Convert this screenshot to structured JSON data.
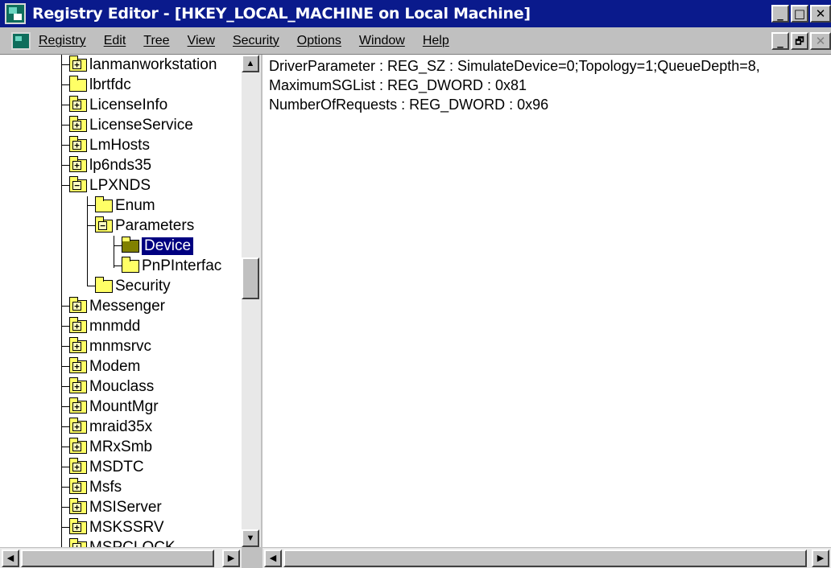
{
  "window": {
    "title": "Registry Editor - [HKEY_LOCAL_MACHINE on Local Machine]",
    "minimize_label": "_",
    "maximize_label": "□",
    "close_label": "✕",
    "mdi_minimize_label": "_",
    "mdi_restore_label": "🗗",
    "mdi_close_label": "✕"
  },
  "menu": [
    "Registry",
    "Edit",
    "Tree",
    "View",
    "Security",
    "Options",
    "Window",
    "Help"
  ],
  "tree": {
    "items": [
      {
        "label": "lanmanworkstation",
        "sign": "+"
      },
      {
        "label": "lbrtfdc",
        "sign": ""
      },
      {
        "label": "LicenseInfo",
        "sign": "+"
      },
      {
        "label": "LicenseService",
        "sign": "+"
      },
      {
        "label": "LmHosts",
        "sign": "+"
      },
      {
        "label": "lp6nds35",
        "sign": "+"
      },
      {
        "label": "LPXNDS",
        "sign": "−"
      },
      {
        "label": "Enum",
        "sign": ""
      },
      {
        "label": "Parameters",
        "sign": "−"
      },
      {
        "label": "Device",
        "sign": ""
      },
      {
        "label": "PnPInterfac",
        "sign": ""
      },
      {
        "label": "Security",
        "sign": ""
      },
      {
        "label": "Messenger",
        "sign": "+"
      },
      {
        "label": "mnmdd",
        "sign": "+"
      },
      {
        "label": "mnmsrvc",
        "sign": "+"
      },
      {
        "label": "Modem",
        "sign": "+"
      },
      {
        "label": "Mouclass",
        "sign": "+"
      },
      {
        "label": "MountMgr",
        "sign": "+"
      },
      {
        "label": "mraid35x",
        "sign": "+"
      },
      {
        "label": "MRxSmb",
        "sign": "+"
      },
      {
        "label": "MSDTC",
        "sign": "+"
      },
      {
        "label": "Msfs",
        "sign": "+"
      },
      {
        "label": "MSIServer",
        "sign": "+"
      },
      {
        "label": "MSKSSRV",
        "sign": "+"
      },
      {
        "label": "MSPCLOCK",
        "sign": "+"
      }
    ],
    "selected": "Device"
  },
  "values": [
    "DriverParameter : REG_SZ : SimulateDevice=0;Topology=1;QueueDepth=8,",
    "MaximumSGList : REG_DWORD : 0x81",
    "NumberOfRequests : REG_DWORD : 0x96"
  ],
  "scroll": {
    "up_arrow": "▲",
    "down_arrow": "▼",
    "left_arrow": "◀",
    "right_arrow": "▶"
  },
  "colors": {
    "titlebar": "#0a1a8c",
    "selection": "#000080",
    "folder": "#ffff66"
  }
}
